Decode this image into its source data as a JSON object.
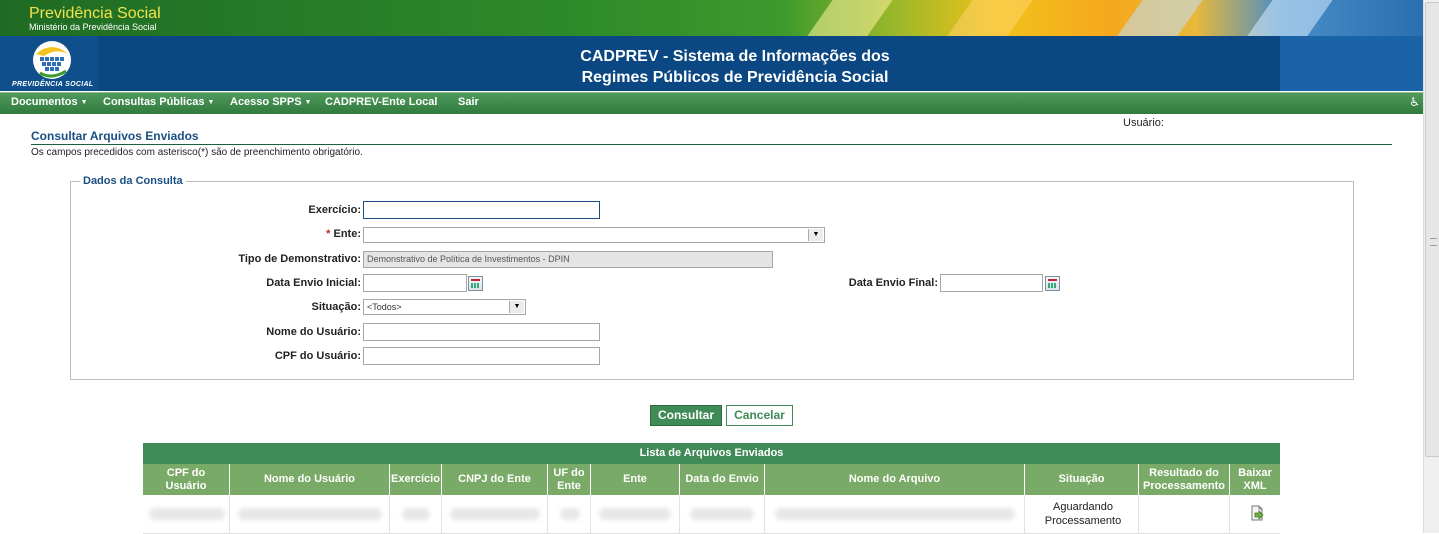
{
  "header": {
    "brand_title": "Previdência Social",
    "brand_subtitle": "Ministério da Previdência Social",
    "logo_text": "PREVIDÊNCIA SOCIAL",
    "system_title_line1": "CADPREV - Sistema de Informações dos",
    "system_title_line2": "Regimes Públicos de Previdência Social"
  },
  "nav": {
    "items": [
      {
        "label": "Documentos",
        "has_dropdown": true
      },
      {
        "label": "Consultas Públicas",
        "has_dropdown": true
      },
      {
        "label": "Acesso SPPS",
        "has_dropdown": true
      },
      {
        "label": "CADPREV-Ente Local",
        "has_dropdown": false
      },
      {
        "label": "Sair",
        "has_dropdown": false
      }
    ],
    "accessibility_icon": "wheelchair-icon"
  },
  "page": {
    "usuario_label": "Usuário:",
    "title": "Consultar Arquivos Enviados",
    "required_note": "Os campos precedidos com asterisco(*) são de preenchimento obrigatório."
  },
  "form": {
    "legend": "Dados da Consulta",
    "exercicio_label": "Exercício:",
    "exercicio_value": "",
    "ente_required": "*",
    "ente_label": "Ente:",
    "ente_value": "",
    "tipo_label": "Tipo de Demonstrativo:",
    "tipo_value": "Demonstrativo de Política de Investimentos - DPIN",
    "data_inicial_label": "Data Envio Inicial:",
    "data_inicial_value": "",
    "data_final_label": "Data Envio Final:",
    "data_final_value": "",
    "situacao_label": "Situação:",
    "situacao_value": "<Todos>",
    "nome_usuario_label": "Nome do Usuário:",
    "nome_usuario_value": "",
    "cpf_usuario_label": "CPF do Usuário:",
    "cpf_usuario_value": ""
  },
  "buttons": {
    "consultar": "Consultar",
    "cancelar": "Cancelar"
  },
  "table": {
    "title": "Lista de Arquivos Enviados",
    "columns": [
      {
        "line1": "CPF do",
        "line2": "Usuário"
      },
      {
        "line1": "Nome do Usuário",
        "line2": ""
      },
      {
        "line1": "Exercício",
        "line2": ""
      },
      {
        "line1": "CNPJ do Ente",
        "line2": ""
      },
      {
        "line1": "UF do",
        "line2": "Ente"
      },
      {
        "line1": "Ente",
        "line2": ""
      },
      {
        "line1": "Data do Envio",
        "line2": ""
      },
      {
        "line1": "Nome do Arquivo",
        "line2": ""
      },
      {
        "line1": "Situação",
        "line2": ""
      },
      {
        "line1": "Resultado do",
        "line2": "Processamento"
      },
      {
        "line1": "Baixar",
        "line2": "XML"
      }
    ],
    "rows": [
      {
        "situacao_line1": "Aguardando",
        "situacao_line2": "Processamento",
        "download_icon": "download-xml-icon"
      }
    ]
  },
  "colors": {
    "nav_green": "#2f7a3c",
    "header_blue": "#0b4782",
    "button_green": "#3f8a56",
    "title_blue": "#1a4f84",
    "required_red": "#b22222"
  }
}
